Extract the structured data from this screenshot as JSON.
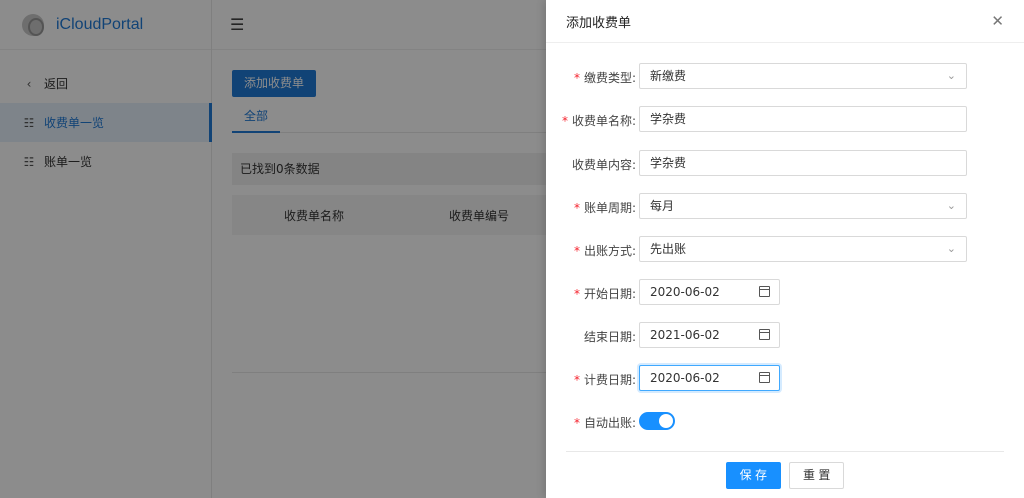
{
  "app": {
    "name": "iCloudPortal"
  },
  "sidebar": {
    "items": [
      {
        "label": "返回",
        "icon": "chevron-left-icon"
      },
      {
        "label": "收费单一览",
        "icon": "document-icon",
        "active": true
      },
      {
        "label": "账单一览",
        "icon": "document-icon"
      }
    ]
  },
  "main": {
    "add_button": "添加收费单",
    "tabs": [
      "全部"
    ],
    "found_text": "已找到0条数据",
    "table": {
      "columns": [
        "收费单名称",
        "收费单编号"
      ]
    }
  },
  "drawer": {
    "title": "添加收费单",
    "fields": {
      "fee_type": {
        "label": "缴费类型:",
        "required": true,
        "value": "新缴费"
      },
      "bill_name": {
        "label": "收费单名称:",
        "required": true,
        "value": "学杂费"
      },
      "bill_content": {
        "label": "收费单内容:",
        "required": false,
        "value": "学杂费"
      },
      "bill_period": {
        "label": "账单周期:",
        "required": true,
        "value": "每月"
      },
      "billing_method": {
        "label": "出账方式:",
        "required": true,
        "value": "先出账"
      },
      "start_date": {
        "label": "开始日期:",
        "required": true,
        "value": "2020-06-02"
      },
      "end_date": {
        "label": "结束日期:",
        "required": false,
        "value": "2021-06-02"
      },
      "charge_date": {
        "label": "计费日期:",
        "required": true,
        "value": "2020-06-02"
      },
      "auto_billing": {
        "label": "自动出账:",
        "required": true,
        "checked": true
      }
    },
    "footer": {
      "save": "保 存",
      "reset": "重 置"
    }
  },
  "colors": {
    "primary": "#1890ff",
    "brand": "#1f7ad8",
    "required": "#f5222d"
  }
}
